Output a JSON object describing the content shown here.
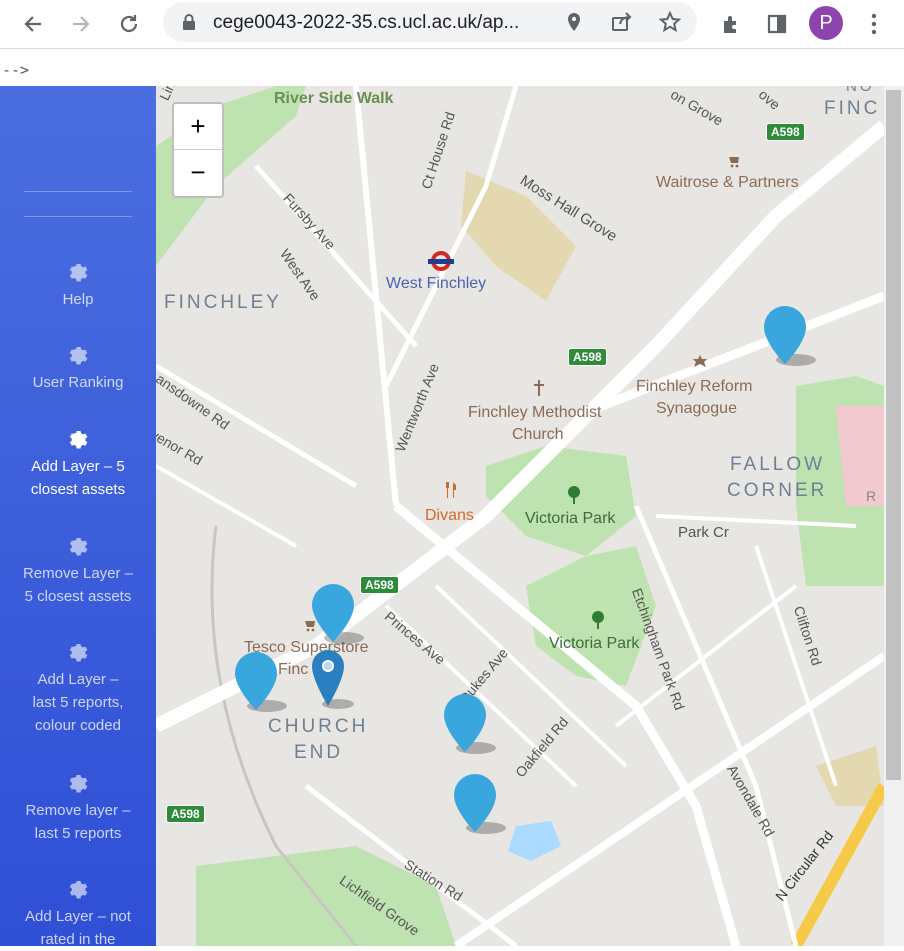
{
  "browser": {
    "url": "cege0043-2022-35.cs.ucl.ac.uk/ap...",
    "profile_initial": "P",
    "icons": [
      "back-icon",
      "forward-icon",
      "reload-icon",
      "lock-icon",
      "location-icon",
      "share-icon",
      "star-icon",
      "extensions-icon",
      "sidepanel-icon",
      "menu-icon"
    ]
  },
  "page": {
    "comment_artifact": "-->"
  },
  "sidebar": {
    "items": [
      {
        "label": "Help"
      },
      {
        "label": "User Ranking"
      },
      {
        "label": "Add Layer – 5 closest assets",
        "active": true
      },
      {
        "label": "Remove Layer – 5 closest assets"
      },
      {
        "label": "Add Layer – last 5 reports, colour coded"
      },
      {
        "label": "Remove layer – last 5 reports"
      },
      {
        "label": "Add Layer – not rated in the"
      }
    ]
  },
  "map": {
    "zoom_in": "+",
    "zoom_out": "−",
    "labels": {
      "river_side_walk": "River Side Walk",
      "ct_house_rd": "Ct House Rd",
      "fursby": "Fursby Ave",
      "west_ave": "West Ave",
      "finchley": "FINCHLEY",
      "west_finchley": "West Finchley",
      "moss_hall": "Moss Hall Grove",
      "waitrose": "Waitrose & Partners",
      "finchley_reform": "Finchley Reform",
      "synagogue": "Synagogue",
      "methodist1": "Finchley Methodist",
      "methodist2": "Church",
      "fallow1": "FALLOW",
      "fallow2": "CORNER",
      "lansdowne": "Lansdowne Rd",
      "venor": "venor Rd",
      "wentworth": "Wentworth Ave",
      "divans": "Divans",
      "victoria_park1": "Victoria Park",
      "victoria_park2": "Victoria Park",
      "park_cr": "Park Cr",
      "tesco": "Tesco Superstore",
      "tesco2": "Finc",
      "church1": "CHURCH",
      "church2": "END",
      "princes": "Princes Ave",
      "dukes": "Dukes Ave",
      "oakfield": "Oakfield Rd",
      "etchingham": "Etchingham Park Rd",
      "clifton": "Clifton Rd",
      "avondale": "Avondale Rd",
      "n_circular": "N Circular Rd",
      "station": "Station Rd",
      "lichfield": "Lichfield Grove",
      "linksid": "Linksid",
      "on_grove": "on Grove",
      "ove": "ove",
      "finc_top": "FINC",
      "nor": "NO",
      "r_right": "R"
    },
    "road_shields": [
      "A598",
      "A598",
      "A598",
      "A598"
    ],
    "colors": {
      "marker": "#39a7dd",
      "marker_dark": "#2a7fc0",
      "park": "#bfe3b0",
      "water": "#aadaff",
      "motorway": "#f7c948"
    }
  }
}
